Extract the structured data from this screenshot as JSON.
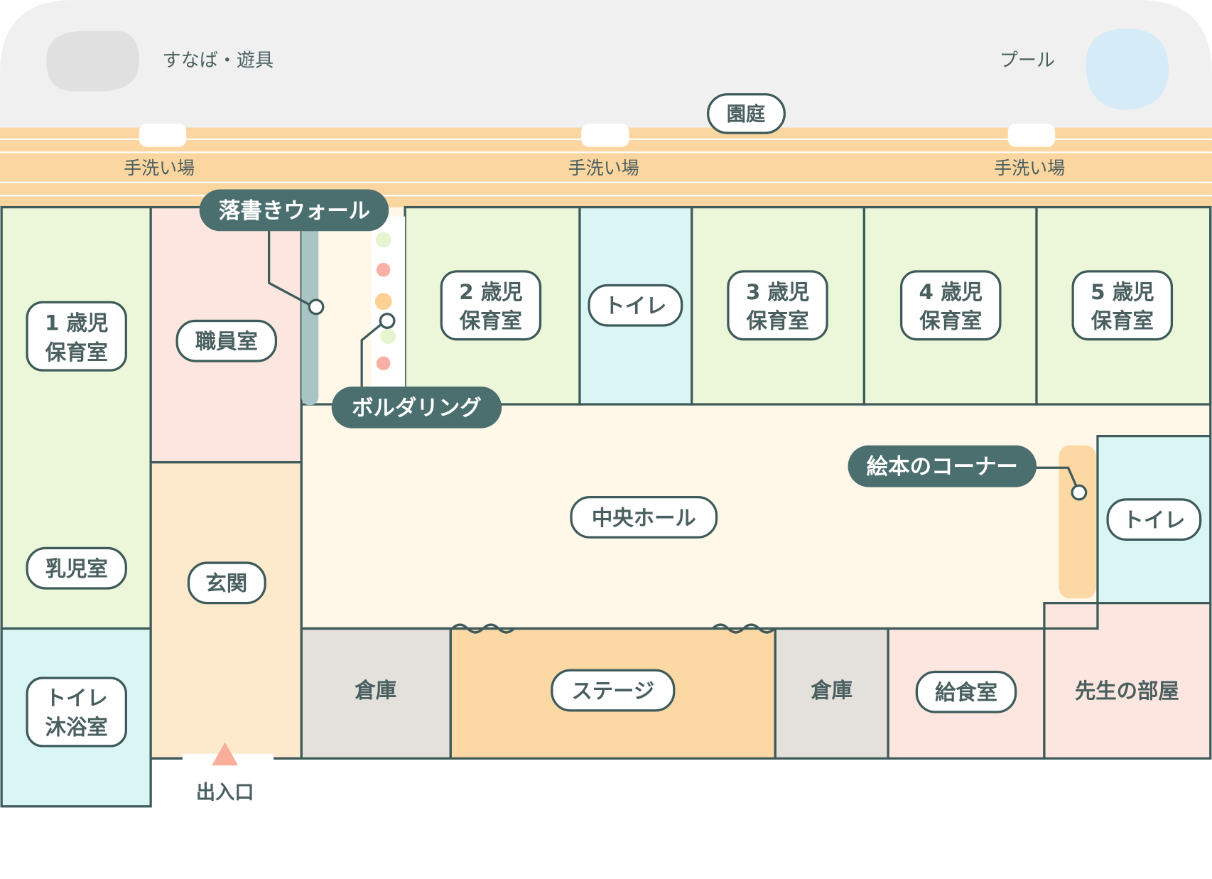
{
  "colors": {
    "green_room": "#ecf7d9",
    "pink_room": "#fde6e0",
    "cyan_room": "#d9f5f4",
    "peach_room": "#fde9cc",
    "hall": "#fff7e8",
    "stage": "#fcd8a5",
    "storage": "#e4e0db",
    "yard": "#f0f0f0",
    "stripe": "#fcd6a0",
    "border": "#3e5a5a",
    "dark_pill": "#4b6e6e",
    "pool": "#d5ebf7",
    "sandbox": "#e0e0e0",
    "entrance_arrow": "#f9ae9c"
  },
  "outdoor": {
    "sandbox_label": "すなば・遊具",
    "pool_label": "プール",
    "yard_label": "園庭",
    "wash_label": "手洗い場"
  },
  "rooms": {
    "age1": [
      "1 歳児",
      "保育室"
    ],
    "infant": "乳児室",
    "toilet_bath": [
      "トイレ",
      "沐浴室"
    ],
    "staff": "職員室",
    "genkan": "玄関",
    "age2": [
      "2 歳児",
      "保育室"
    ],
    "toilet_mid": "トイレ",
    "age3": [
      "3 歳児",
      "保育室"
    ],
    "age4": [
      "4 歳児",
      "保育室"
    ],
    "age5": [
      "5 歳児",
      "保育室"
    ],
    "hall": "中央ホール",
    "toilet_right": "トイレ",
    "storage_left": "倉庫",
    "stage": "ステージ",
    "storage_right": "倉庫",
    "kitchen": "給食室",
    "teacher": "先生の部屋",
    "entrance": "出入口"
  },
  "callouts": {
    "graffiti": "落書きウォール",
    "bouldering": "ボルダリング",
    "picturebook": "絵本のコーナー"
  },
  "bouldering_hold_colors": [
    "#e6f4cf",
    "#f9b0a4",
    "#fbd293",
    "#ffffff",
    "#e6f4cf",
    "#f9b0a4"
  ]
}
